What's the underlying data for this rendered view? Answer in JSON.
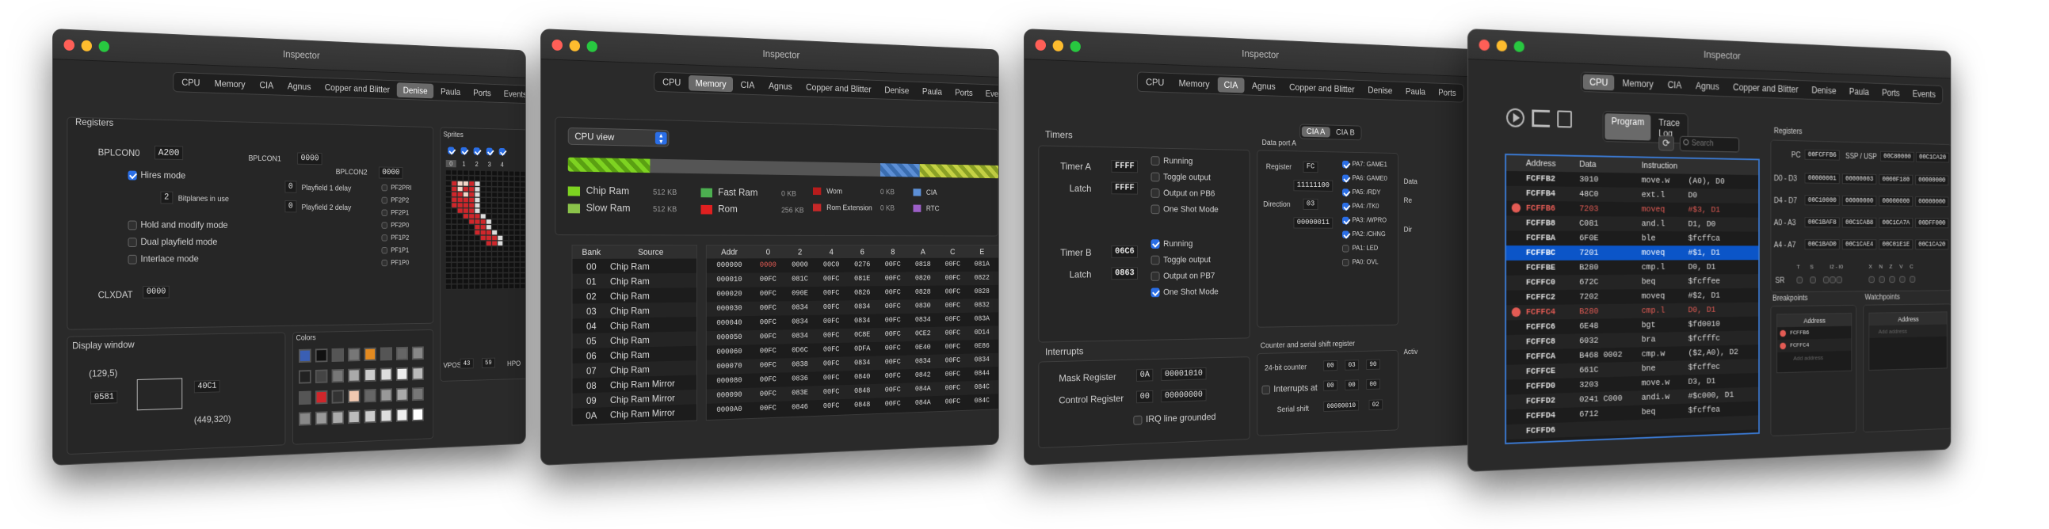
{
  "window_title": "Inspector",
  "win1": {
    "tabs": [
      "CPU",
      "Memory",
      "CIA",
      "Agnus",
      "Copper and Blitter",
      "Denise",
      "Paula",
      "Ports",
      "Events"
    ],
    "selected_tab": "Denise",
    "registers_title": "Registers",
    "bplcon0": {
      "label": "BPLCON0",
      "value": "A200"
    },
    "bplcon1": {
      "label": "BPLCON1",
      "value": "0000"
    },
    "bplcon2": {
      "label": "BPLCON2",
      "value": "0000"
    },
    "hires": "Hires mode",
    "bitplanes_value": "2",
    "bitplanes": "Bitplanes in use",
    "pf1delay_value": "0",
    "pf1delay": "Playfield 1 delay",
    "pf2delay_value": "0",
    "pf2delay": "Playfield 2 delay",
    "hold": "Hold and modify mode",
    "dual": "Dual playfield mode",
    "interlace": "Interlace mode",
    "pf_flags": [
      "PF2PRI",
      "PF2P2",
      "PF2P1",
      "PF2P0",
      "PF1P2",
      "PF1P1",
      "PF1P0"
    ],
    "clxdat": {
      "label": "CLXDAT",
      "value": "0000"
    },
    "sprites_title": "Sprites",
    "sprite_nums": [
      "0",
      "1",
      "2",
      "3",
      "4"
    ],
    "vpos": {
      "label": "VPOS",
      "value": "43",
      "value2": "59",
      "hpos": "HPO"
    },
    "display_title": "Display window",
    "dw_tl": "(129,5)",
    "dw_val1": "0581",
    "dw_val2": "40C1",
    "dw_br": "(449,320)",
    "colors_title": "Colors"
  },
  "win2": {
    "tabs": [
      "CPU",
      "Memory",
      "CIA",
      "Agnus",
      "Copper and Blitter",
      "Denise",
      "Paula",
      "Ports",
      "Eve"
    ],
    "selected_tab": "Memory",
    "view_select": "CPU view",
    "legend": [
      {
        "name": "Chip Ram",
        "size": "512 KB",
        "color": "#7ed321"
      },
      {
        "name": "Slow Ram",
        "size": "512 KB",
        "color": "#8bc34a"
      },
      {
        "name": "Fast Ram",
        "size": "0 KB",
        "color": "#4caf50"
      },
      {
        "name": "Rom",
        "size": "256 KB",
        "color": "#e02020"
      },
      {
        "name": "Wom",
        "size": "0 KB",
        "color": "#b71c1c"
      },
      {
        "name": "Rom Extension",
        "size": "0 KB",
        "color": "#c62828"
      },
      {
        "name": "CIA",
        "size": "",
        "color": "#5c8fd6"
      },
      {
        "name": "RTC",
        "size": "",
        "color": "#9c5fc7"
      }
    ],
    "bank_headers": [
      "Bank",
      "Source"
    ],
    "banks": [
      [
        "00",
        "Chip Ram"
      ],
      [
        "01",
        "Chip Ram"
      ],
      [
        "02",
        "Chip Ram"
      ],
      [
        "03",
        "Chip Ram"
      ],
      [
        "04",
        "Chip Ram"
      ],
      [
        "05",
        "Chip Ram"
      ],
      [
        "06",
        "Chip Ram"
      ],
      [
        "07",
        "Chip Ram"
      ],
      [
        "08",
        "Chip Ram Mirror"
      ],
      [
        "09",
        "Chip Ram Mirror"
      ],
      [
        "0A",
        "Chip Ram Mirror"
      ]
    ],
    "dump_headers": [
      "Addr",
      "0",
      "2",
      "4",
      "6",
      "8",
      "A",
      "C",
      "E"
    ],
    "dump": [
      [
        "000000",
        "0000",
        "0000",
        "00C0",
        "0276",
        "00FC",
        "0818",
        "00FC",
        "081A"
      ],
      [
        "000010",
        "00FC",
        "081C",
        "00FC",
        "081E",
        "00FC",
        "0820",
        "00FC",
        "0822"
      ],
      [
        "000020",
        "00FC",
        "090E",
        "00FC",
        "0826",
        "00FC",
        "0828",
        "00FC",
        "0828"
      ],
      [
        "000030",
        "00FC",
        "0834",
        "00FC",
        "0834",
        "00FC",
        "0830",
        "00FC",
        "0832"
      ],
      [
        "000040",
        "00FC",
        "0834",
        "00FC",
        "0834",
        "00FC",
        "0834",
        "00FC",
        "083A"
      ],
      [
        "000050",
        "00FC",
        "0834",
        "00FC",
        "0C8E",
        "00FC",
        "0CE2",
        "00FC",
        "0D14"
      ],
      [
        "000060",
        "00FC",
        "0D6C",
        "00FC",
        "0DFA",
        "00FC",
        "0E40",
        "00FC",
        "0E86"
      ],
      [
        "000070",
        "00FC",
        "0838",
        "00FC",
        "0834",
        "00FC",
        "0834",
        "00FC",
        "0834"
      ],
      [
        "000080",
        "00FC",
        "0836",
        "00FC",
        "0840",
        "00FC",
        "0842",
        "00FC",
        "0844"
      ],
      [
        "000090",
        "00FC",
        "083E",
        "00FC",
        "0848",
        "00FC",
        "084A",
        "00FC",
        "084C"
      ],
      [
        "0000A0",
        "00FC",
        "0846",
        "00FC",
        "0848",
        "00FC",
        "084A",
        "00FC",
        "084C"
      ]
    ]
  },
  "win3": {
    "tabs": [
      "CPU",
      "Memory",
      "CIA",
      "Agnus",
      "Copper and Blitter",
      "Denise",
      "Paula",
      "Ports"
    ],
    "selected_tab": "CIA",
    "cia_a": "CIA A",
    "cia_b": "CIA B",
    "timers_title": "Timers",
    "timer_a": {
      "label": "Timer A",
      "value": "FFFF"
    },
    "latch_a": {
      "label": "Latch",
      "value": "FFFF"
    },
    "timer_b": {
      "label": "Timer B",
      "value": "06C6"
    },
    "latch_b": {
      "label": "Latch",
      "value": "0863"
    },
    "ta_opts": [
      {
        "t": "Running",
        "on": false
      },
      {
        "t": "Toggle output",
        "on": false
      },
      {
        "t": "Output on PB6",
        "on": false
      },
      {
        "t": "One Shot Mode",
        "on": false
      }
    ],
    "tb_opts": [
      {
        "t": "Running",
        "on": true
      },
      {
        "t": "Toggle output",
        "on": false
      },
      {
        "t": "Output on PB7",
        "on": false
      },
      {
        "t": "One Shot Mode",
        "on": true
      }
    ],
    "port_title": "Data port A",
    "register_label": "Register",
    "register_value": "FC",
    "register_bits": "11111100",
    "direction_label": "Direction",
    "direction_value": "03",
    "direction_bits": "00000011",
    "pa_bits": [
      {
        "t": "PA7: GAME1",
        "on": true
      },
      {
        "t": "PA6: GAME0",
        "on": true
      },
      {
        "t": "PA5: /RDY",
        "on": true
      },
      {
        "t": "PA4: /TK0",
        "on": true
      },
      {
        "t": "PA3: /WPRO",
        "on": true
      },
      {
        "t": "PA2: /CHNG",
        "on": true
      },
      {
        "t": "PA1: LED",
        "on": false
      },
      {
        "t": "PA0: OVL",
        "on": false
      }
    ],
    "interrupts_title": "Interrupts",
    "mask_label": "Mask Register",
    "mask_hex": "0A",
    "mask_bin": "00001010",
    "ctrl_label": "Control Register",
    "ctrl_hex": "00",
    "ctrl_bin": "00000000",
    "irq": "IRQ line grounded",
    "counter_title": "Counter and serial shift register",
    "tod_label": "24-bit counter",
    "tod": [
      "00",
      "03",
      "90"
    ],
    "alarm_label": "Interrupts at",
    "alarm": [
      "00",
      "00",
      "00"
    ],
    "serial_label": "Serial shift",
    "serial_bin": "00000010",
    "serial_hex": "02",
    "right_frag1": "Data",
    "right_frag2": "Re",
    "right_frag3": "Dir",
    "right_frag4": "Activ"
  },
  "win4": {
    "tabs": [
      "CPU",
      "Memory",
      "CIA",
      "Agnus",
      "Copper and Blitter",
      "Denise",
      "Paula",
      "Ports",
      "Events"
    ],
    "selected_tab": "CPU",
    "subtabs": [
      "Program",
      "Trace Log"
    ],
    "selected_subtab": "Program",
    "search_placeholder": "Search",
    "headers": [
      "Address",
      "Data",
      "Instruction"
    ],
    "instructions": [
      {
        "addr": "FCFFB2",
        "data": "3010",
        "ins": "move.w",
        "op": "(A0), D0",
        "bp": false,
        "hl": false,
        "red": false
      },
      {
        "addr": "FCFFB4",
        "data": "48C0",
        "ins": "ext.l",
        "op": "D0",
        "bp": false,
        "hl": false,
        "red": false
      },
      {
        "addr": "FCFFB6",
        "data": "7203",
        "ins": "moveq",
        "op": "#$3, D1",
        "bp": true,
        "hl": false,
        "red": true
      },
      {
        "addr": "FCFFB8",
        "data": "C081",
        "ins": "and.l",
        "op": "D1, D0",
        "bp": false,
        "hl": false,
        "red": false
      },
      {
        "addr": "FCFFBA",
        "data": "6F0E",
        "ins": "ble",
        "op": "$fcffca",
        "bp": false,
        "hl": false,
        "red": false
      },
      {
        "addr": "FCFFBC",
        "data": "7201",
        "ins": "moveq",
        "op": "#$1, D1",
        "bp": false,
        "hl": true,
        "red": false
      },
      {
        "addr": "FCFFBE",
        "data": "B280",
        "ins": "cmp.l",
        "op": "D0, D1",
        "bp": false,
        "hl": false,
        "red": false
      },
      {
        "addr": "FCFFC0",
        "data": "672C",
        "ins": "beq",
        "op": "$fcffee",
        "bp": false,
        "hl": false,
        "red": false
      },
      {
        "addr": "FCFFC2",
        "data": "7202",
        "ins": "moveq",
        "op": "#$2, D1",
        "bp": false,
        "hl": false,
        "red": false
      },
      {
        "addr": "FCFFC4",
        "data": "B280",
        "ins": "cmp.l",
        "op": "D0, D1",
        "bp": true,
        "hl": false,
        "red": true
      },
      {
        "addr": "FCFFC6",
        "data": "6E48",
        "ins": "bgt",
        "op": "$fd0010",
        "bp": false,
        "hl": false,
        "red": false
      },
      {
        "addr": "FCFFC8",
        "data": "6032",
        "ins": "bra",
        "op": "$fcfffc",
        "bp": false,
        "hl": false,
        "red": false
      },
      {
        "addr": "FCFFCA",
        "data": "B468 0002",
        "ins": "cmp.w",
        "op": "($2,A0), D2",
        "bp": false,
        "hl": false,
        "red": false
      },
      {
        "addr": "FCFFCE",
        "data": "661C",
        "ins": "bne",
        "op": "$fcffec",
        "bp": false,
        "hl": false,
        "red": false
      },
      {
        "addr": "FCFFD0",
        "data": "3203",
        "ins": "move.w",
        "op": "D3, D1",
        "bp": false,
        "hl": false,
        "red": false
      },
      {
        "addr": "FCFFD2",
        "data": "0241 C000",
        "ins": "andi.w",
        "op": "#$c000, D1",
        "bp": false,
        "hl": false,
        "red": false
      },
      {
        "addr": "FCFFD4",
        "data": "6712",
        "ins": "beq",
        "op": "$fcffea",
        "bp": false,
        "hl": false,
        "red": false
      },
      {
        "addr": "FCFFD6",
        "data": "",
        "ins": "",
        "op": "",
        "bp": false,
        "hl": false,
        "red": false
      }
    ],
    "registers_title": "Registers",
    "pc_label": "PC",
    "pc_value": "00FCFFB6",
    "ssp_label": "SSP / USP",
    "ssp": "00C80000",
    "usp": "00C1CA20",
    "reg_rows": [
      {
        "label": "D0 - D3",
        "vals": [
          "00000001",
          "00000003",
          "0000F180",
          "00000000"
        ]
      },
      {
        "label": "D4 - D7",
        "vals": [
          "00C10000",
          "00000000",
          "00000000",
          "00000000"
        ]
      },
      {
        "label": "A0 - A3",
        "vals": [
          "00C1BAF8",
          "00C1CAB8",
          "00C1CA7A",
          "00DFF000"
        ]
      },
      {
        "label": "A4 - A7",
        "vals": [
          "00C1BAD0",
          "00C1CAE4",
          "00C01E1E",
          "00C1CA20"
        ]
      }
    ],
    "sr_label": "SR",
    "sr_bits": [
      "T",
      "S",
      "I2 - I0",
      "X",
      "N",
      "Z",
      "V",
      "C"
    ],
    "breakpoints_title": "Breakpoints",
    "bp_header": "Address",
    "breakpoints": [
      "FCFFB6",
      "FCFFC4"
    ],
    "bp_add": "Add address",
    "watchpoints_title": "Watchpoints",
    "wp_header": "Address",
    "wp_add": "Add address"
  },
  "colors": {
    "accent": "#0a5fd6",
    "breakpoint": "#e35b54",
    "highlight_row": "#0b55c8",
    "panel_bg": "#2a2a2a"
  }
}
